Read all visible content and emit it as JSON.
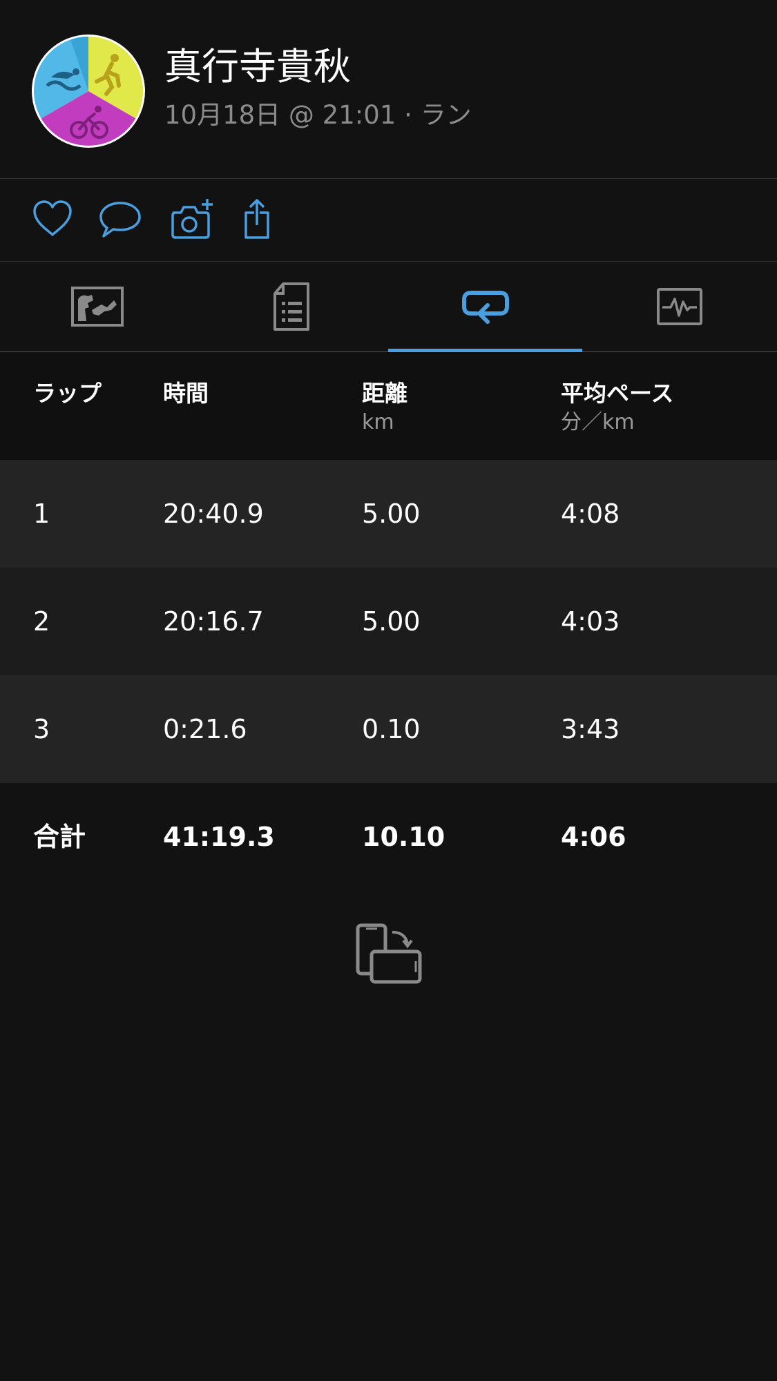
{
  "header": {
    "name": "真行寺貴秋",
    "subtitle": "10月18日 @ 21:01 · ラン",
    "avatar_icon": "triathlon-avatar-icon"
  },
  "actions": [
    {
      "icon": "heart-icon"
    },
    {
      "icon": "comment-icon"
    },
    {
      "icon": "add-photo-icon"
    },
    {
      "icon": "share-icon"
    }
  ],
  "tabs": [
    {
      "icon": "map-icon",
      "active": false
    },
    {
      "icon": "document-list-icon",
      "active": false
    },
    {
      "icon": "laps-loop-icon",
      "active": true
    },
    {
      "icon": "chart-icon",
      "active": false
    }
  ],
  "colors": {
    "accent": "#4a9fe0",
    "background": "#121212",
    "row_odd": "#242424",
    "row_even": "#1c1c1c"
  },
  "table": {
    "headers": {
      "lap": "ラップ",
      "time": "時間",
      "distance": "距離",
      "distance_unit": "km",
      "pace": "平均ペース",
      "pace_unit": "分／km"
    },
    "rows": [
      {
        "lap": "1",
        "time": "20:40.9",
        "distance": "5.00",
        "pace": "4:08"
      },
      {
        "lap": "2",
        "time": "20:16.7",
        "distance": "5.00",
        "pace": "4:03"
      },
      {
        "lap": "3",
        "time": "0:21.6",
        "distance": "0.10",
        "pace": "3:43"
      }
    ],
    "total": {
      "label": "合計",
      "time": "41:19.3",
      "distance": "10.10",
      "pace": "4:06"
    }
  },
  "footer": {
    "rotate_icon": "rotate-device-icon"
  }
}
